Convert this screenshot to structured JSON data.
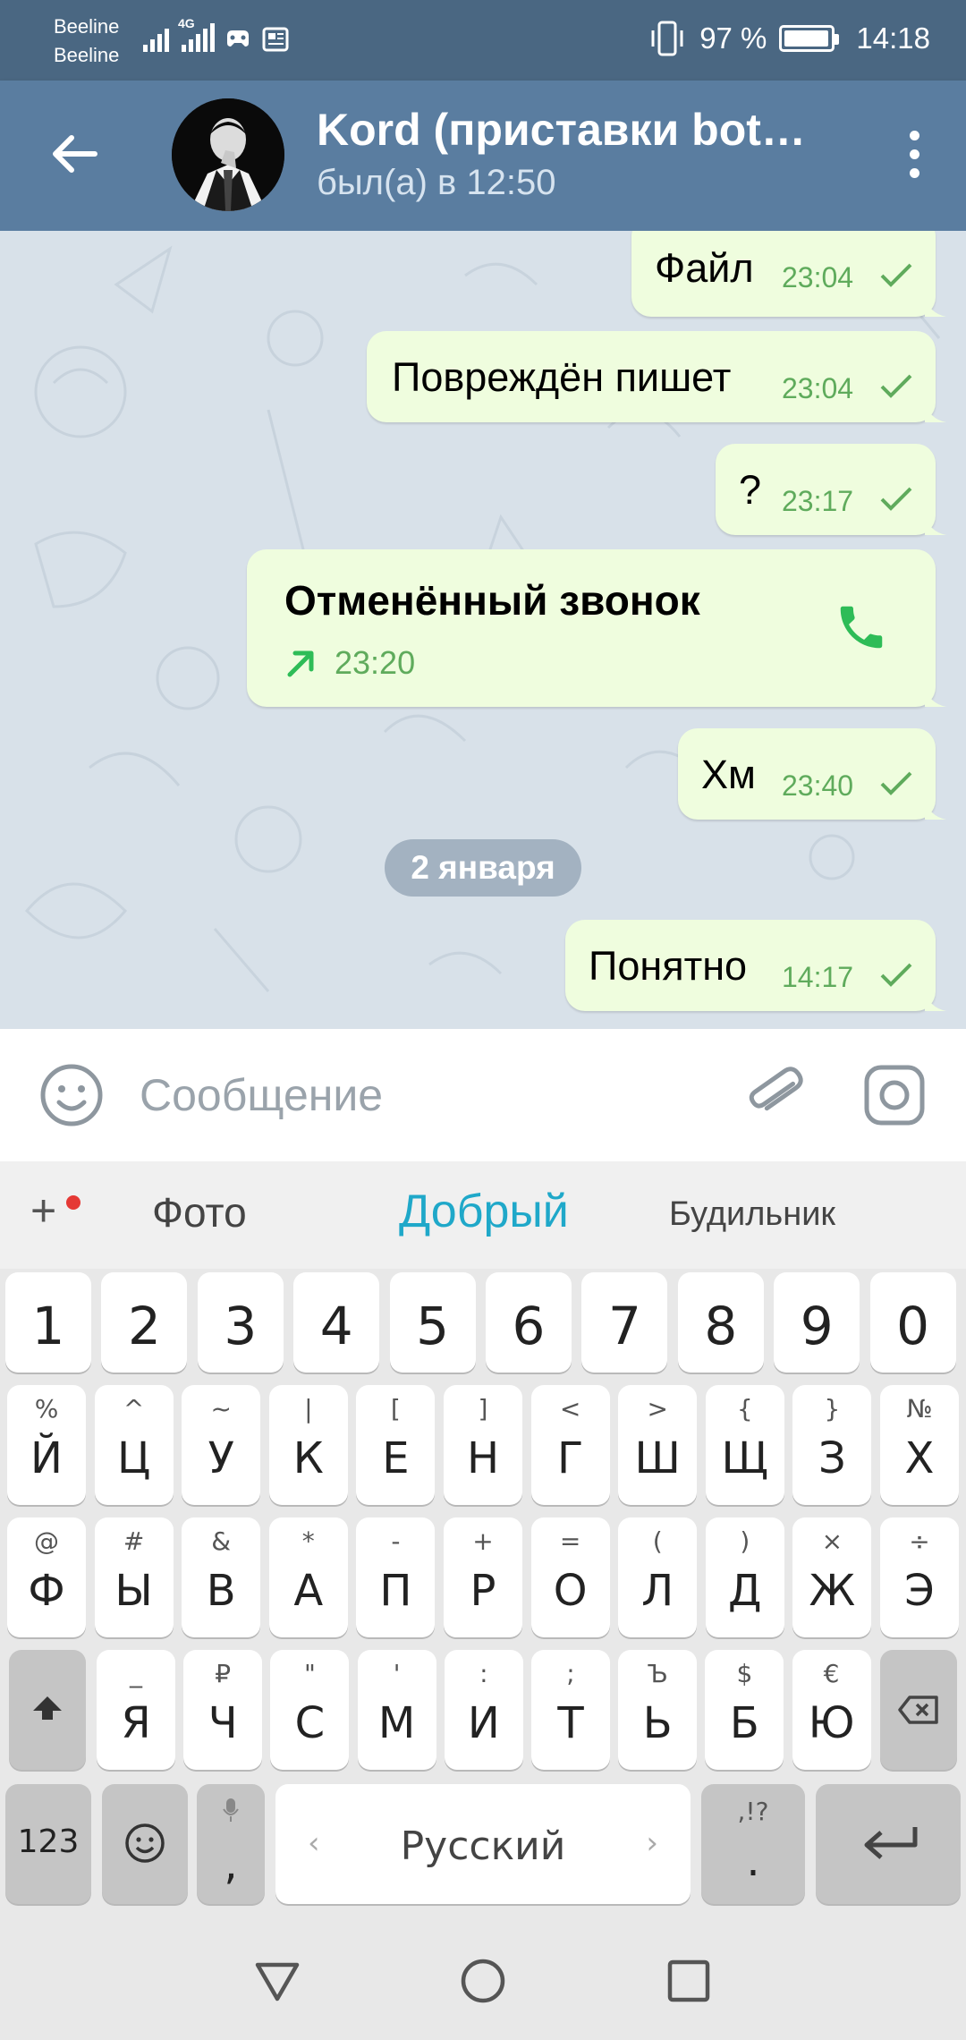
{
  "status_bar": {
    "carrier_1": "Beeline",
    "carrier_2": "Beeline",
    "network": "4G",
    "battery_percent": "97 %",
    "battery_level": 0.97,
    "time": "14:18"
  },
  "header": {
    "title": "Kord (приставки bot…",
    "status": "был(а) в 12:50"
  },
  "messages": [
    {
      "text": "Файл",
      "time": "23:04",
      "read": true
    },
    {
      "text": "Повреждён пишет",
      "time": "23:04",
      "read": true
    },
    {
      "text": "?",
      "time": "23:17",
      "read": true
    },
    {
      "type": "call",
      "text": "Отменённый звонок",
      "time": "23:20",
      "direction": "outgoing"
    },
    {
      "text": "Хм",
      "time": "23:40",
      "read": true
    },
    {
      "type": "date",
      "text": "2 января"
    },
    {
      "text": "Понятно",
      "time": "14:17",
      "read": true
    }
  ],
  "input": {
    "placeholder": "Сообщение"
  },
  "suggestions": {
    "plus": "+",
    "left": "Фото",
    "middle": "Добрый",
    "right": "Будильник"
  },
  "keyboard": {
    "numbers": [
      "1",
      "2",
      "3",
      "4",
      "5",
      "6",
      "7",
      "8",
      "9",
      "0"
    ],
    "row1": [
      [
        "%",
        "Й"
      ],
      [
        "^",
        "Ц"
      ],
      [
        "~",
        "У"
      ],
      [
        "|",
        "К"
      ],
      [
        "[",
        "Е"
      ],
      [
        "]",
        "Н"
      ],
      [
        "<",
        "Г"
      ],
      [
        ">",
        "Ш"
      ],
      [
        "{",
        "Щ"
      ],
      [
        "}",
        "З"
      ],
      [
        "№",
        "Х"
      ]
    ],
    "row2": [
      [
        "@",
        "Ф"
      ],
      [
        "#",
        "Ы"
      ],
      [
        "&",
        "В"
      ],
      [
        "*",
        "А"
      ],
      [
        "-",
        "П"
      ],
      [
        "+",
        "Р"
      ],
      [
        "=",
        "О"
      ],
      [
        "(",
        "Л"
      ],
      [
        ")",
        "Д"
      ],
      [
        "×",
        "Ж"
      ],
      [
        "÷",
        "Э"
      ]
    ],
    "row3": [
      [
        "_",
        "Я"
      ],
      [
        "₽",
        "Ч"
      ],
      [
        "\"",
        "С"
      ],
      [
        "'",
        "М"
      ],
      [
        ":",
        "И"
      ],
      [
        ";",
        "Т"
      ],
      [
        "Ъ",
        "Ь"
      ],
      [
        "$",
        "Б"
      ],
      [
        "€",
        "Ю"
      ]
    ],
    "numbers_key": "123",
    "comma": ",",
    "space_label": "Русский",
    "period_sub": ",!?",
    "period": "."
  },
  "colors": {
    "header": "#5a7da0",
    "status_bar": "#4a6782",
    "bubble_out": "#effdde",
    "time_green": "#5fab5c",
    "suggest_accent": "#1fa8c9"
  }
}
